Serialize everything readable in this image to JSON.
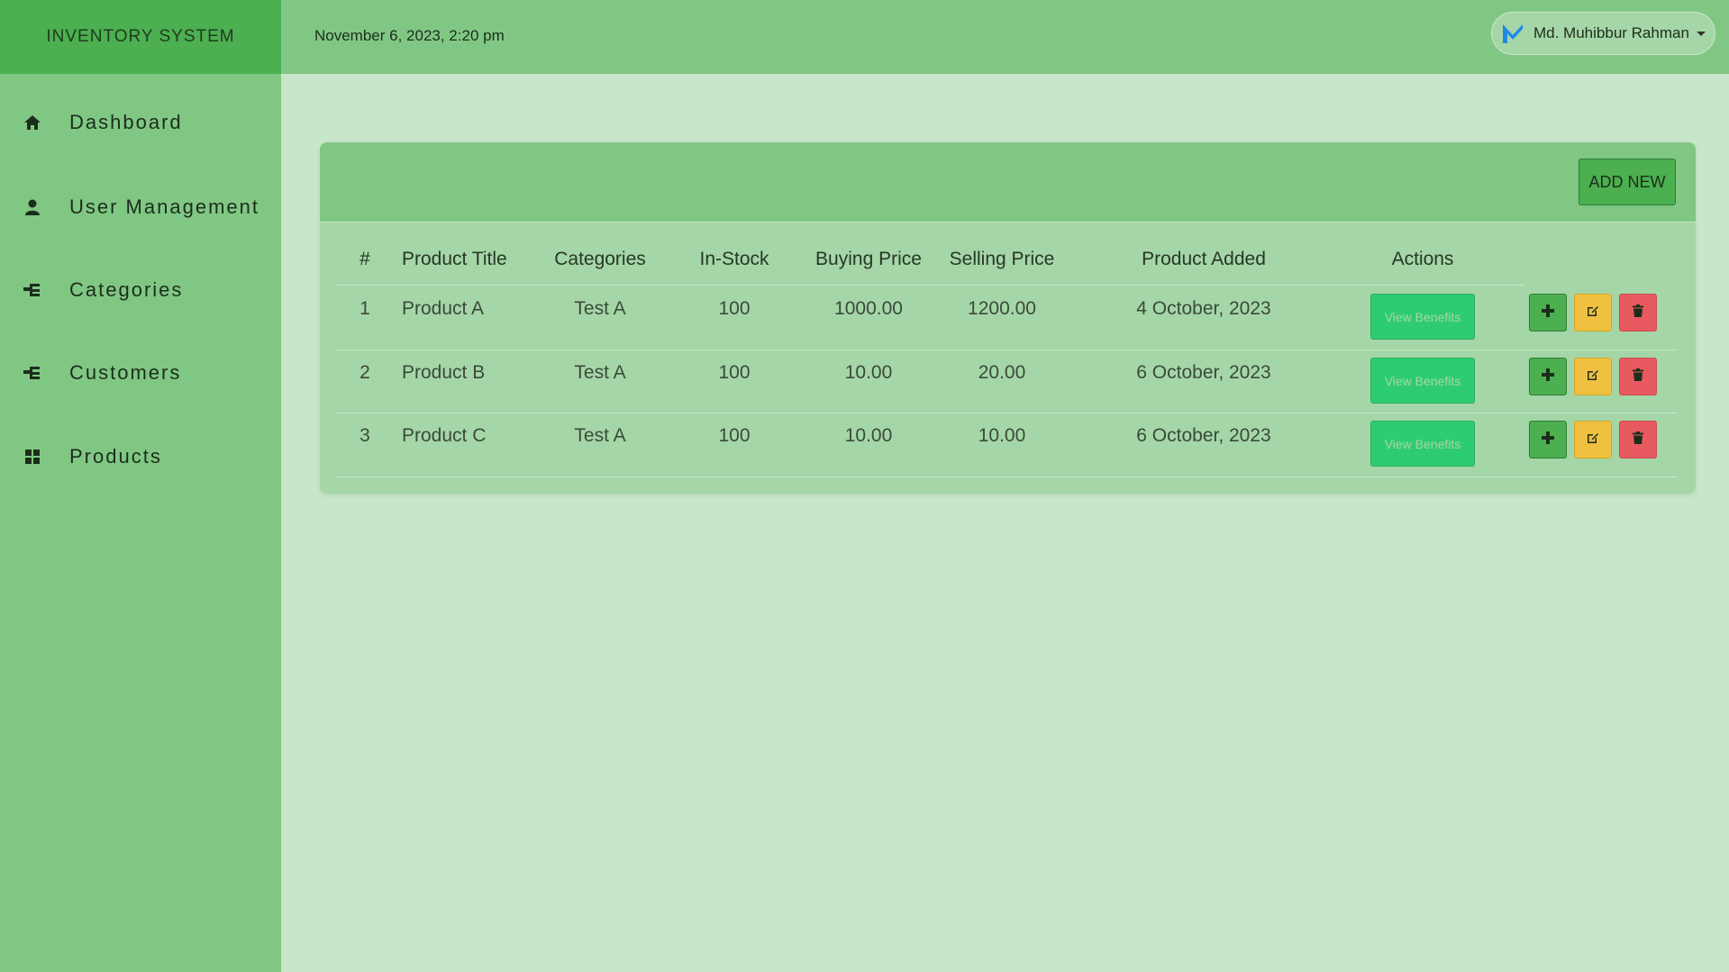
{
  "app": {
    "brand": "INVENTORY SYSTEM"
  },
  "topbar": {
    "datetime": "November 6, 2023, 2:20 pm",
    "user_name": "Md. Muhibbur Rahman"
  },
  "sidebar": {
    "items": [
      {
        "label": "Dashboard",
        "icon": "home-icon"
      },
      {
        "label": "User Management",
        "icon": "user-icon"
      },
      {
        "label": "Categories",
        "icon": "sitemap-icon"
      },
      {
        "label": "Customers",
        "icon": "sitemap-icon"
      },
      {
        "label": "Products",
        "icon": "grid-icon"
      }
    ]
  },
  "panel": {
    "add_label": "ADD NEW"
  },
  "table": {
    "headers": [
      "#",
      "Product Title",
      "Categories",
      "In-Stock",
      "Buying Price",
      "Selling Price",
      "Product Added",
      "Actions"
    ],
    "rows": [
      {
        "num": "1",
        "title": "Product A",
        "category": "Test A",
        "stock": "100",
        "buy": "1000.00",
        "sell": "1200.00",
        "added": "4 October, 2023",
        "benefits": "View Benefits"
      },
      {
        "num": "2",
        "title": "Product B",
        "category": "Test A",
        "stock": "100",
        "buy": "10.00",
        "sell": "20.00",
        "added": "6 October, 2023",
        "benefits": "View Benefits"
      },
      {
        "num": "3",
        "title": "Product C",
        "category": "Test A",
        "stock": "100",
        "buy": "10.00",
        "sell": "10.00",
        "added": "6 October, 2023",
        "benefits": "View Benefits"
      }
    ]
  },
  "colors": {
    "sidebar": "#81c784",
    "brand": "#4caf50",
    "background": "#c8e6c9",
    "panel": "#a5d6a7",
    "view_benefits": "#2ecc71",
    "edit": "#f0c040",
    "delete": "#e85a5f"
  }
}
